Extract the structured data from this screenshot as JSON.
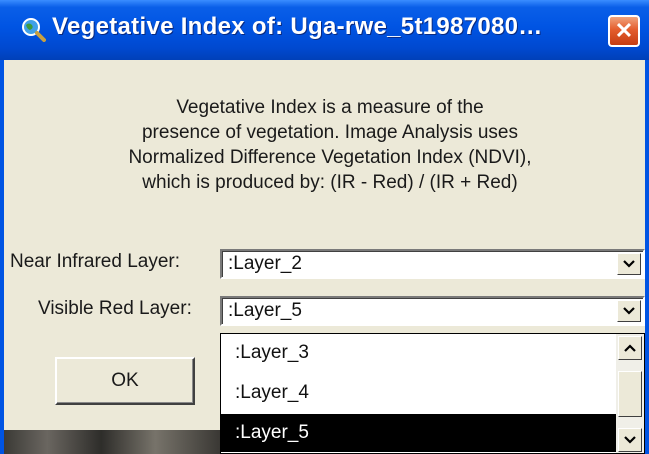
{
  "window": {
    "title": "Vegetative Index of: Uga-rwe_5t1987080…",
    "close_label": "✕"
  },
  "description": {
    "line1": "Vegetative Index is a measure of the",
    "line2": "presence of vegetation.  Image Analysis uses",
    "line3": "Normalized Difference Vegetation Index (NDVI),",
    "line4": "which is produced by:  (IR - Red) / (IR + Red)"
  },
  "near_infrared": {
    "label": "Near Infrared Layer:",
    "value": ":Layer_2"
  },
  "visible_red": {
    "label": "Visible Red Layer:",
    "value": ":Layer_5"
  },
  "dropdown": {
    "items": [
      ":Layer_3",
      ":Layer_4",
      ":Layer_5"
    ],
    "selected": ":Layer_5"
  },
  "buttons": {
    "ok_label": "OK"
  },
  "icons": {
    "title": "magnifier-globe-icon",
    "close": "close-icon",
    "combo_arrow": "chevron-down-icon"
  },
  "colors": {
    "titlebar": "#0054E3",
    "close": "#E45D2D",
    "face": "#ECE9D8",
    "selection": "#000000"
  }
}
